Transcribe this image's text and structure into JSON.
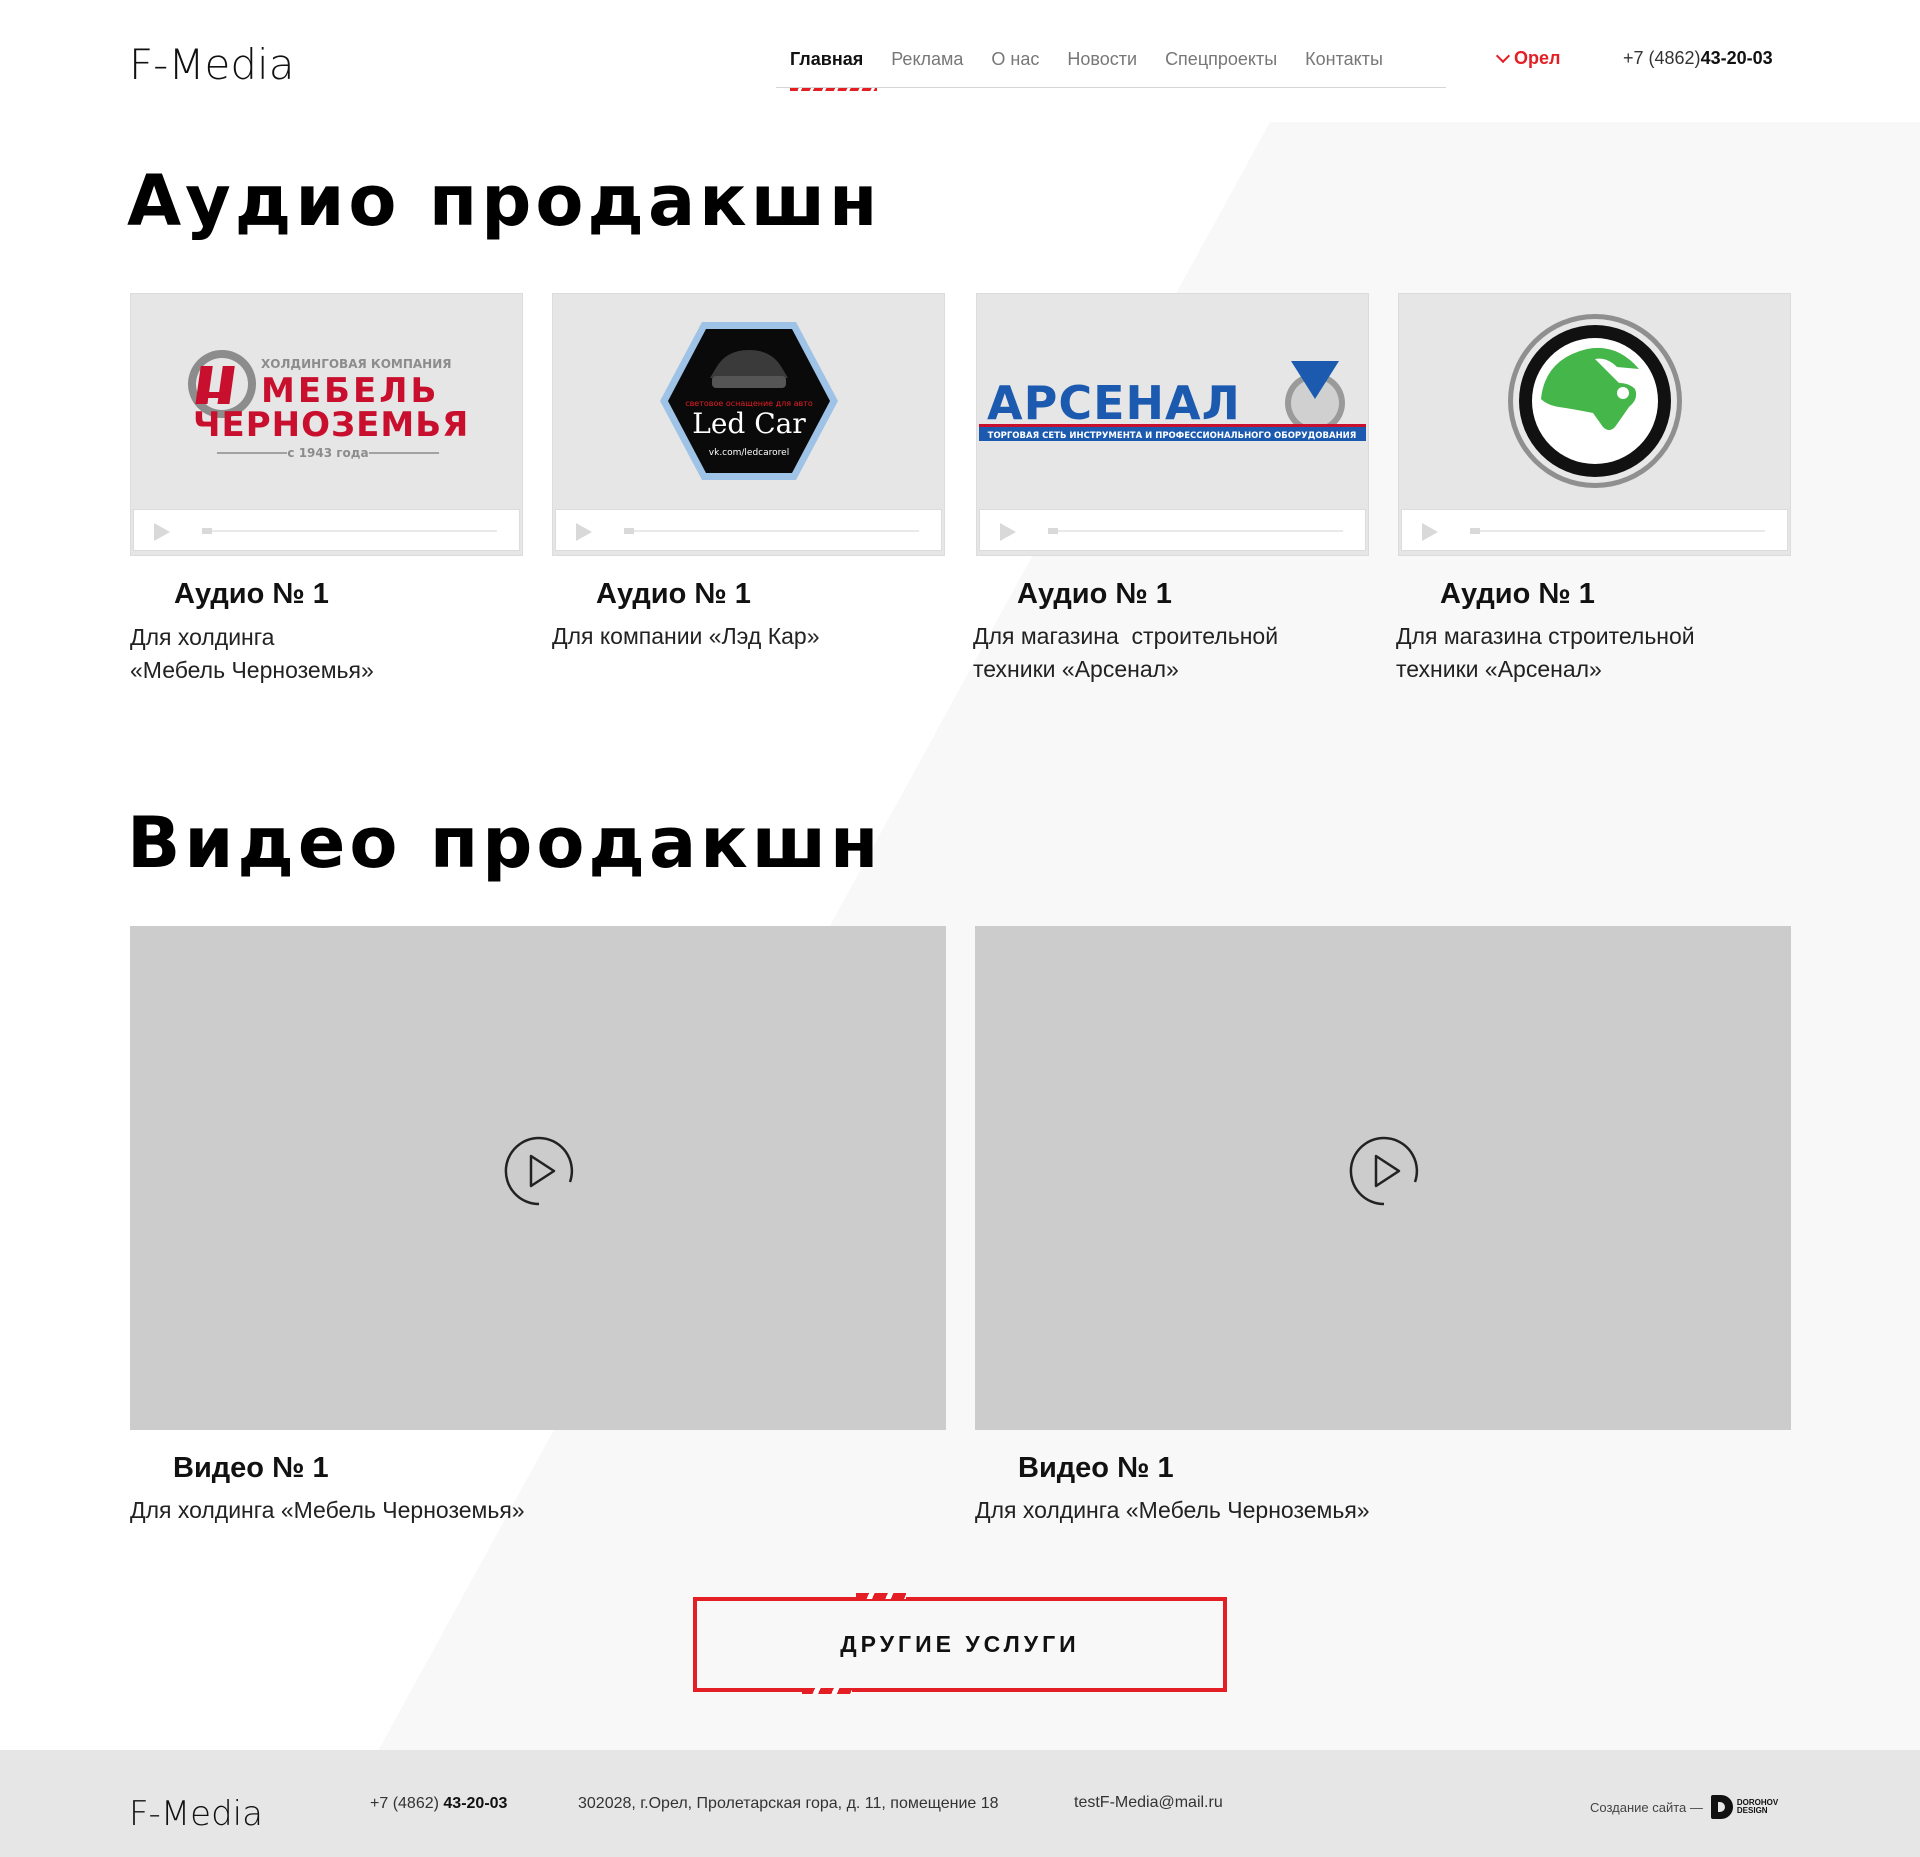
{
  "header": {
    "logo": "F-Media",
    "nav": [
      "Главная",
      "Реклама",
      "О нас",
      "Новости",
      "Спецпроекты",
      "Контакты"
    ],
    "nav_active": 0,
    "city": "Орел",
    "phone_prefix": "+7 (4862)",
    "phone_main": "43-20-03"
  },
  "audio": {
    "title": "Аудио продакшн",
    "items": [
      {
        "title": "Аудио № 1",
        "desc_line1": "Для холдинга",
        "desc_line2": "«Мебель Черноземья»",
        "logo": {
          "top": "ХОЛДИНГОВАЯ КОМПАНИЯ",
          "line1": "МЕБЕЛЬ",
          "line2": "ЧЕРНОЗЕМЬЯ",
          "since": "с 1943 года"
        }
      },
      {
        "title": "Аудио № 1",
        "desc_line1": "Для компании «Лэд Кар»",
        "desc_line2": "",
        "logo": {
          "top": "световое оснащение для авто",
          "name": "Led Car",
          "url": "vk.com/ledcarorel"
        }
      },
      {
        "title": "Аудио № 1",
        "desc_line1": "Для магазина  строительной",
        "desc_line2": "техники «Арсенал»",
        "logo": {
          "name": "АРСЕНАЛ",
          "sub": "ТОРГОВАЯ СЕТЬ ИНСТРУМЕНТА И ПРОФЕССИОНАЛЬНОГО ОБОРУДОВАНИЯ"
        }
      },
      {
        "title": "Аудио № 1",
        "desc_line1": "Для магазина строительной",
        "desc_line2": "техники «Арсенал»",
        "logo": {
          "icon": "skoda-logo-icon"
        }
      }
    ]
  },
  "video": {
    "title": "Видео продакшн",
    "items": [
      {
        "title": "Видео № 1",
        "desc": "Для холдинга «Мебель Черноземья»"
      },
      {
        "title": "Видео № 1",
        "desc": "Для холдинга «Мебель Черноземья»"
      }
    ]
  },
  "cta": {
    "label": "ДРУГИЕ УСЛУГИ"
  },
  "footer": {
    "logo": "F-Media",
    "phone_prefix": "+7 (4862) ",
    "phone_main": "43-20-03",
    "address": "302028, г.Орел, Пролетарская гора, д. 11, помещение 18",
    "email": "testF-Media@mail.ru",
    "credit": "Создание сайта —",
    "studio_line1": "DOROHOV",
    "studio_line2": "DESIGN"
  },
  "colors": {
    "accent": "#e31e24",
    "footer_bg": "#e6e6e6",
    "placeholder": "#cccccc"
  }
}
